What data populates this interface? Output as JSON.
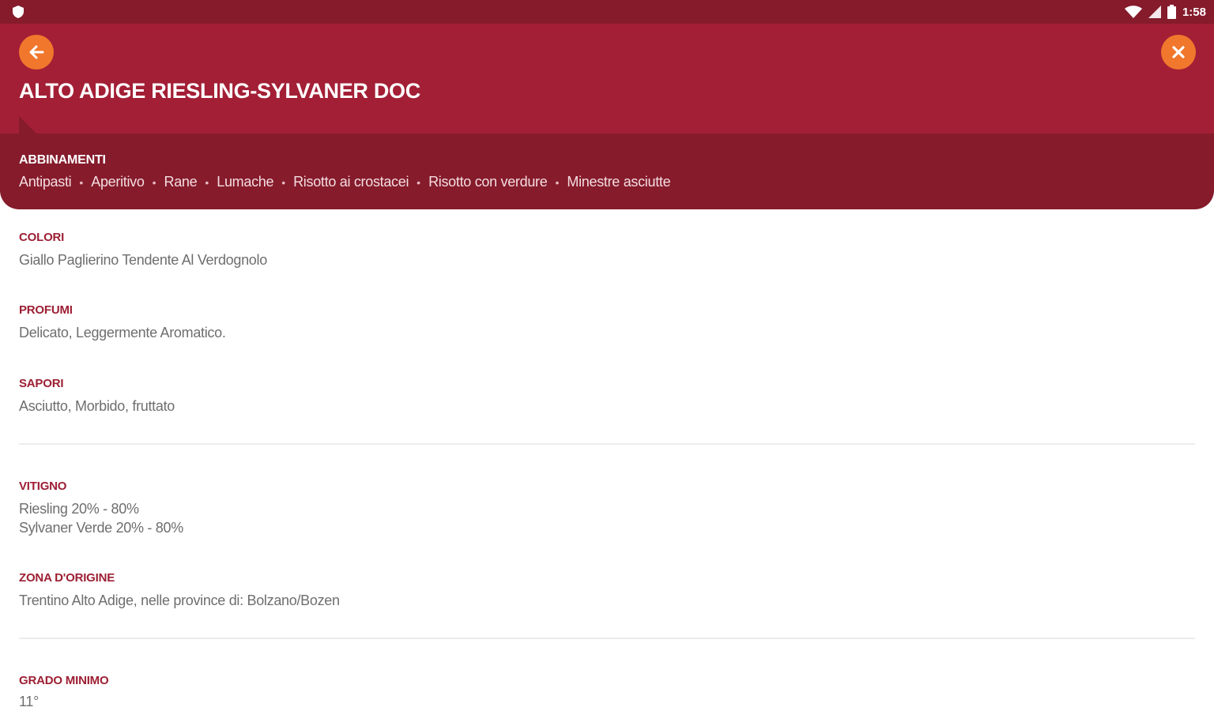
{
  "status_bar": {
    "time": "1:58",
    "icons": [
      "shield-icon",
      "wifi-icon",
      "signal-icon",
      "battery-icon"
    ]
  },
  "header": {
    "title": "ALTO ADIGE RIESLING-SYLVANER DOC",
    "back_icon": "arrow-left-icon",
    "close_icon": "close-icon"
  },
  "pairings": {
    "label": "ABBINAMENTI",
    "items": [
      "Antipasti",
      "Aperitivo",
      "Rane",
      "Lumache",
      "Risotto ai crostacei",
      "Risotto con verdure",
      "Minestre asciutte"
    ]
  },
  "details": {
    "colori": {
      "label": "COLORI",
      "value": "Giallo Paglierino Tendente Al Verdognolo"
    },
    "profumi": {
      "label": "PROFUMI",
      "value": "Delicato, Leggermente Aromatico."
    },
    "sapori": {
      "label": "SAPORI",
      "value": "Asciutto, Morbido, fruttato"
    },
    "vitigno": {
      "label": "VITIGNO",
      "line1": "Riesling 20% - 80%",
      "line2": "Sylvaner Verde 20% - 80%"
    },
    "zona": {
      "label": "ZONA D'ORIGINE",
      "value": "Trentino Alto Adige, nelle province di: Bolzano/Bozen"
    },
    "grado": {
      "label": "GRADO MINIMO",
      "value": "11°"
    }
  },
  "colors": {
    "header": "#a31f36",
    "dark": "#851b2b",
    "accent": "#f0772c",
    "label": "#9c1f33"
  }
}
